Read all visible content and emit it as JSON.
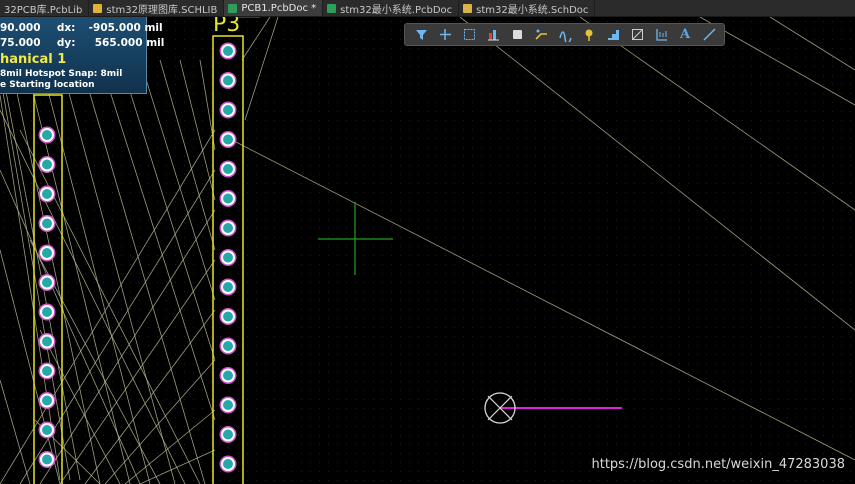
{
  "tabs": [
    {
      "label": "32PCB库.PcbLib",
      "icon": "pcblib-icon",
      "active": false
    },
    {
      "label": "stm32原理图库.SCHLIB",
      "icon": "schlib-icon",
      "active": false
    },
    {
      "label": "PCB1.PcbDoc *",
      "icon": "pcbdoc-icon",
      "active": true
    },
    {
      "label": "stm32最小系统.PcbDoc",
      "icon": "pcbdoc-icon",
      "active": false
    },
    {
      "label": "stm32最小系统.SchDoc",
      "icon": "schdoc-icon",
      "active": false
    }
  ],
  "hud": {
    "x_value": "90.000",
    "dx_label": "dx:",
    "dx_value": "-905.000 mil",
    "y_value": "75.000",
    "dy_label": "dy:",
    "dy_value": "565.000 mil",
    "layer": "hanical 1",
    "snap": "8mil Hotspot Snap: 8mil",
    "hint": "e Starting location"
  },
  "toolbar": [
    {
      "name": "filter-icon"
    },
    {
      "name": "add-icon"
    },
    {
      "name": "select-rect-icon"
    },
    {
      "name": "align-icon"
    },
    {
      "name": "component-icon"
    },
    {
      "name": "route-icon"
    },
    {
      "name": "interactive-route-icon"
    },
    {
      "name": "place-pad-icon"
    },
    {
      "name": "polygon-icon"
    },
    {
      "name": "region-icon"
    },
    {
      "name": "dimension-icon"
    },
    {
      "name": "text-icon"
    },
    {
      "name": "line-icon"
    }
  ],
  "toolbar_text": "A",
  "designators": {
    "right_header": "P3"
  },
  "colors": {
    "pad_ring": "#d050d0",
    "pad_fill": "#24a8a8",
    "silk": "#e6e628",
    "ratsnest": "#b8b894",
    "cursor": "#1ea01e",
    "track": "#e020e0",
    "tab_bg": "#2b2b2b"
  },
  "watermark": "https://blog.csdn.net/weixin_47283038"
}
